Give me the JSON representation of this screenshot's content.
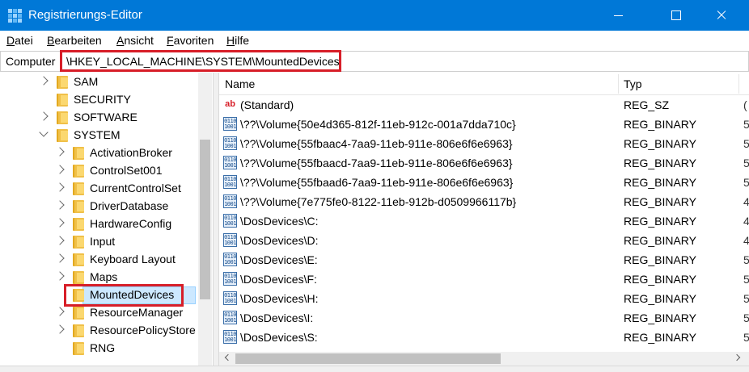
{
  "window": {
    "title": "Registrierungs-Editor"
  },
  "menu": [
    {
      "mnemonic": "D",
      "rest": "atei"
    },
    {
      "mnemonic": "B",
      "rest": "earbeiten"
    },
    {
      "mnemonic": "A",
      "rest": "nsicht"
    },
    {
      "mnemonic": "F",
      "rest": "avoriten"
    },
    {
      "mnemonic": "H",
      "rest": "ilfe"
    }
  ],
  "address": {
    "root": "Computer",
    "path": "\\HKEY_LOCAL_MACHINE\\SYSTEM\\MountedDevices"
  },
  "tree": [
    {
      "label": "SAM",
      "level": 0,
      "expander": "closed",
      "selected": false
    },
    {
      "label": "SECURITY",
      "level": 0,
      "expander": "none",
      "selected": false
    },
    {
      "label": "SOFTWARE",
      "level": 0,
      "expander": "closed",
      "selected": false
    },
    {
      "label": "SYSTEM",
      "level": 0,
      "expander": "open",
      "selected": false
    },
    {
      "label": "ActivationBroker",
      "level": 1,
      "expander": "closed",
      "selected": false
    },
    {
      "label": "ControlSet001",
      "level": 1,
      "expander": "closed",
      "selected": false
    },
    {
      "label": "CurrentControlSet",
      "level": 1,
      "expander": "closed",
      "selected": false
    },
    {
      "label": "DriverDatabase",
      "level": 1,
      "expander": "closed",
      "selected": false
    },
    {
      "label": "HardwareConfig",
      "level": 1,
      "expander": "closed",
      "selected": false
    },
    {
      "label": "Input",
      "level": 1,
      "expander": "closed",
      "selected": false
    },
    {
      "label": "Keyboard Layout",
      "level": 1,
      "expander": "closed",
      "selected": false
    },
    {
      "label": "Maps",
      "level": 1,
      "expander": "closed",
      "selected": false
    },
    {
      "label": "MountedDevices",
      "level": 1,
      "expander": "none",
      "selected": true
    },
    {
      "label": "ResourceManager",
      "level": 1,
      "expander": "closed",
      "selected": false
    },
    {
      "label": "ResourcePolicyStore",
      "level": 1,
      "expander": "closed",
      "selected": false
    },
    {
      "label": "RNG",
      "level": 1,
      "expander": "none",
      "selected": false
    }
  ],
  "columns": {
    "name": "Name",
    "type": "Typ"
  },
  "values": [
    {
      "name": "(Standard)",
      "type": "REG_SZ",
      "icon": "string-value-icon",
      "extra": "("
    },
    {
      "name": "\\??\\Volume{50e4d365-812f-11eb-912c-001a7dda710c}",
      "type": "REG_BINARY",
      "icon": "binary-value-icon",
      "extra": "5"
    },
    {
      "name": "\\??\\Volume{55fbaac4-7aa9-11eb-911e-806e6f6e6963}",
      "type": "REG_BINARY",
      "icon": "binary-value-icon",
      "extra": "5"
    },
    {
      "name": "\\??\\Volume{55fbaacd-7aa9-11eb-911e-806e6f6e6963}",
      "type": "REG_BINARY",
      "icon": "binary-value-icon",
      "extra": "5"
    },
    {
      "name": "\\??\\Volume{55fbaad6-7aa9-11eb-911e-806e6f6e6963}",
      "type": "REG_BINARY",
      "icon": "binary-value-icon",
      "extra": "5"
    },
    {
      "name": "\\??\\Volume{7e775fe0-8122-11eb-912b-d0509966117b}",
      "type": "REG_BINARY",
      "icon": "binary-value-icon",
      "extra": "4"
    },
    {
      "name": "\\DosDevices\\C:",
      "type": "REG_BINARY",
      "icon": "binary-value-icon",
      "extra": "4"
    },
    {
      "name": "\\DosDevices\\D:",
      "type": "REG_BINARY",
      "icon": "binary-value-icon",
      "extra": "4"
    },
    {
      "name": "\\DosDevices\\E:",
      "type": "REG_BINARY",
      "icon": "binary-value-icon",
      "extra": "5"
    },
    {
      "name": "\\DosDevices\\F:",
      "type": "REG_BINARY",
      "icon": "binary-value-icon",
      "extra": "5"
    },
    {
      "name": "\\DosDevices\\H:",
      "type": "REG_BINARY",
      "icon": "binary-value-icon",
      "extra": "5"
    },
    {
      "name": "\\DosDevices\\I:",
      "type": "REG_BINARY",
      "icon": "binary-value-icon",
      "extra": "5"
    },
    {
      "name": "\\DosDevices\\S:",
      "type": "REG_BINARY",
      "icon": "binary-value-icon",
      "extra": "5"
    }
  ],
  "colors": {
    "titlebar": "#0078d7",
    "highlight": "#d71e28",
    "selection": "#cce8ff"
  }
}
